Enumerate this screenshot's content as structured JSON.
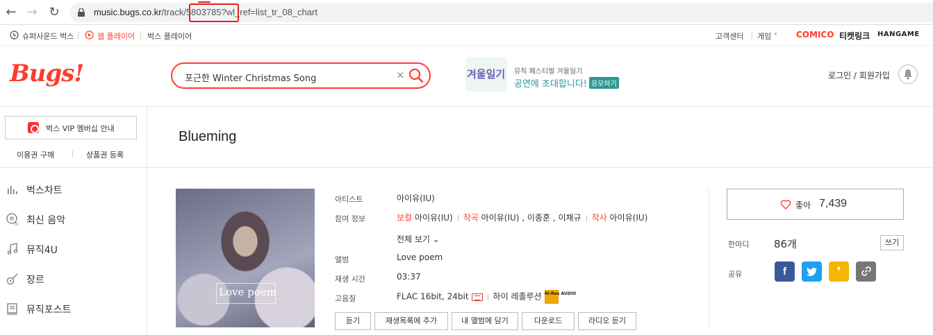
{
  "browser": {
    "url_host": "music.bugs.co.kr",
    "url_path": "/track/5803785?wl_ref=list_tr_08_chart"
  },
  "util": {
    "left": [
      "슈퍼사운드 벅스",
      "웹 플레이어",
      "벅스 플레이어"
    ],
    "right": [
      "고객센터",
      "게임"
    ],
    "partners": [
      "COMICO",
      "티켓링크",
      "HANGAME"
    ]
  },
  "header": {
    "logo": "Bugs!",
    "search_value": "포근한 Winter Christmas Song",
    "promo_image_text": "겨울일기",
    "promo_small": "뮤직 페스티벌 겨울일기",
    "promo_big": "공연에 초대합니다!",
    "promo_badge": "응모하기",
    "login": "로그인 / 회원가입"
  },
  "sidebar": {
    "vip": "벅스 VIP 멤버십 안내",
    "links": [
      "이용권 구매",
      "상품권 등록"
    ],
    "menu": [
      {
        "label": "벅스차트",
        "icon": "chart-icon"
      },
      {
        "label": "최신 음악",
        "icon": "new-music-icon"
      },
      {
        "label": "뮤직4U",
        "icon": "music-note-icon"
      },
      {
        "label": "장르",
        "icon": "guitar-icon"
      },
      {
        "label": "뮤직포스트",
        "icon": "post-icon"
      }
    ]
  },
  "track": {
    "title": "Blueming",
    "album_art_text": "Love poem",
    "labels": {
      "artist": "아티스트",
      "credits": "참여 정보",
      "album": "앨범",
      "duration": "재생 시간",
      "quality": "고음질"
    },
    "artist": "아이유(IU)",
    "credits": {
      "vocal_role": "보컬",
      "vocal": "아이유(IU)",
      "composer_role": "작곡",
      "composer": "아이유(IU) , 이종훈 , 이채규",
      "lyricist_role": "작사",
      "lyricist": "아이유(IU)",
      "view_all": "전체 보기 ⌄"
    },
    "album": "Love poem",
    "duration": "03:37",
    "quality": "FLAC 16bit, 24bit",
    "hires": "하이 레졸루션",
    "hires_badge": "Hi-Res AUDIO",
    "actions": [
      "듣기",
      "재생목록에 추가",
      "내 앨범에 담기",
      "다운로드",
      "라디오 듣기"
    ]
  },
  "social": {
    "like_label": "좋아",
    "like_count": "7,439",
    "comment_label": "한마디",
    "comment_count": "86개",
    "write": "쓰기",
    "share_label": "공유",
    "share": [
      {
        "name": "facebook",
        "glyph": "f",
        "color": "#3b5998"
      },
      {
        "name": "twitter",
        "glyph": "t",
        "color": "#1da1f2"
      },
      {
        "name": "kakaostory",
        "glyph": "❜",
        "color": "#f7b500"
      },
      {
        "name": "link",
        "glyph": "∞",
        "color": "#777777"
      }
    ]
  },
  "colors": {
    "brand": "#ff3c2d",
    "promo": "#2a9a90"
  }
}
